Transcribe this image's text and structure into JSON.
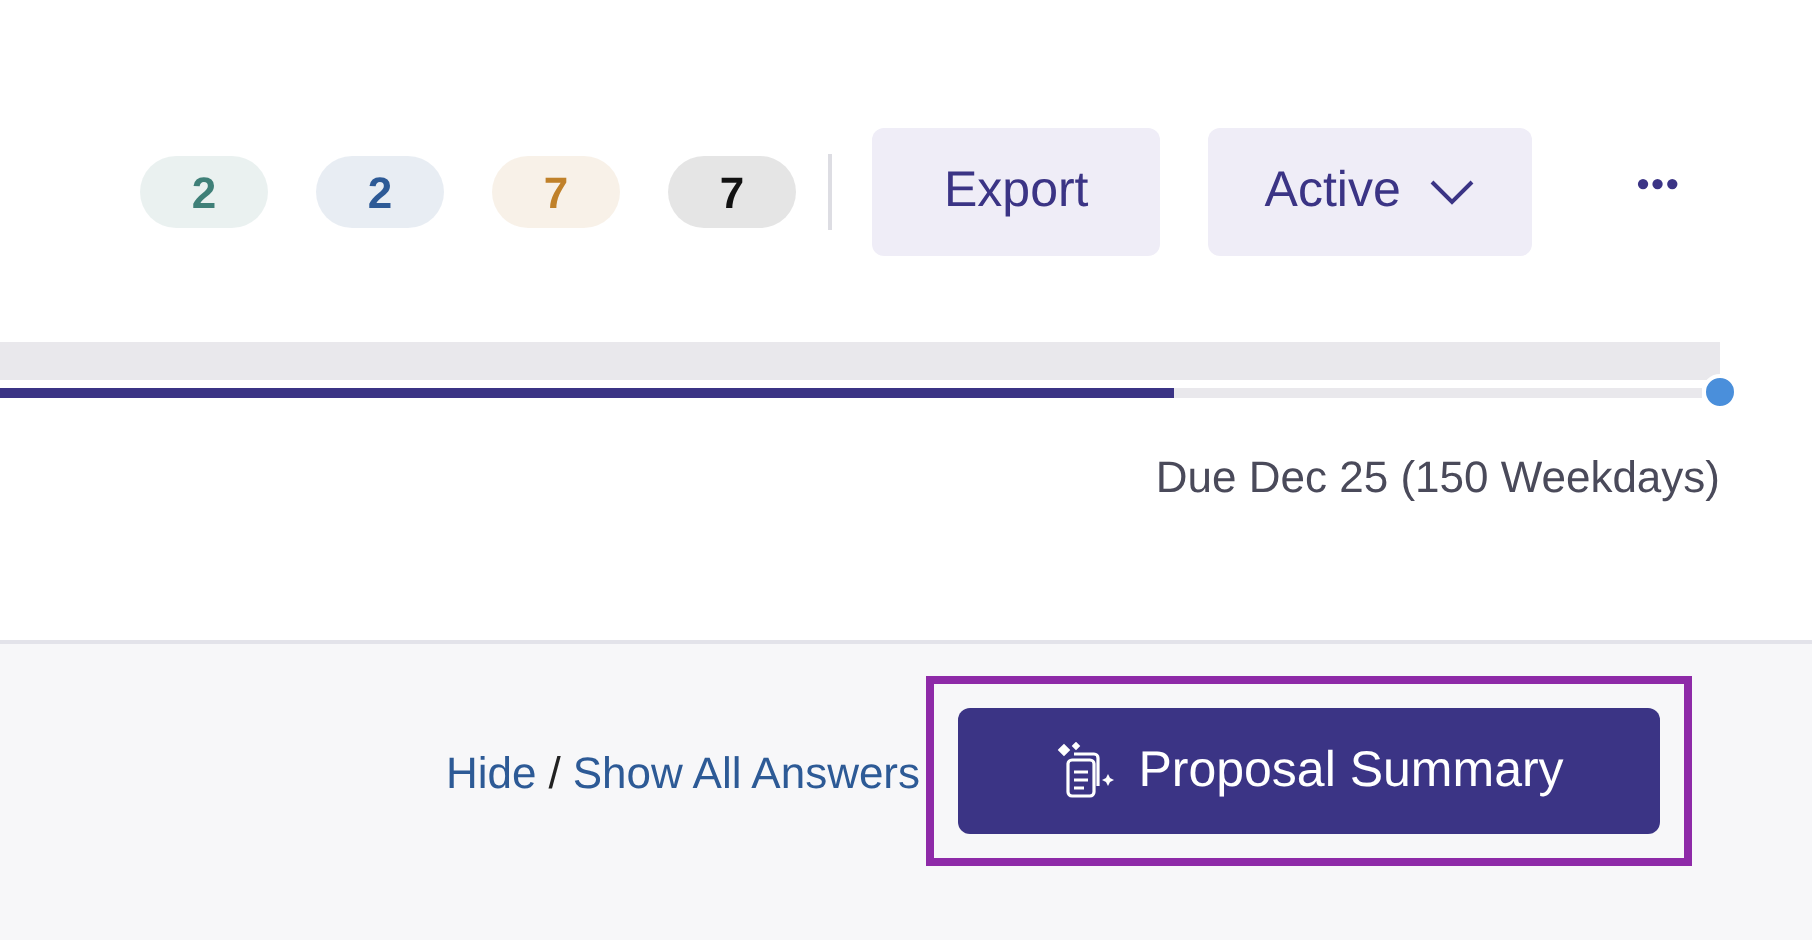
{
  "badges": [
    {
      "count": "2",
      "color": "#3f8078"
    },
    {
      "count": "2",
      "color": "#2d5a96"
    },
    {
      "count": "7",
      "color": "#c0812a"
    },
    {
      "count": "7",
      "color": "#111111"
    }
  ],
  "buttons": [
    {
      "label": "Export",
      "kind": "plain"
    },
    {
      "label": "Active",
      "kind": "dropdown"
    }
  ],
  "more_menu": {
    "label": "•••"
  },
  "progress": {
    "level": 0.69,
    "due": "Due Dec 25 (150 Weekdays)"
  },
  "answers_toggle": {
    "hide": "Hide",
    "separator": "/",
    "show": "Show All Answers"
  },
  "summary_button": {
    "label": "Proposal Summary",
    "highlighted": true
  }
}
